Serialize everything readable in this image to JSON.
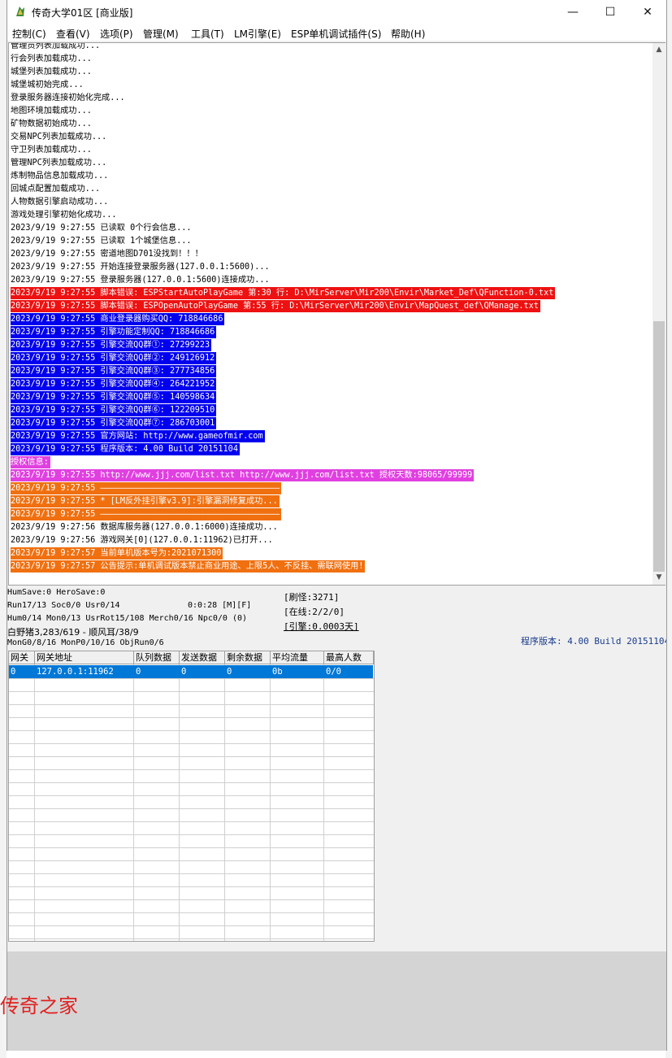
{
  "window": {
    "title": "传奇大学01区 [商业版]",
    "controls": {
      "minimize": "—",
      "maximize": "☐",
      "close": "✕"
    }
  },
  "menu": [
    "控制(C)",
    "查看(V)",
    "选项(P)",
    "管理(M)",
    "工具(T)",
    "LM引擎(E)",
    "ESP单机调试插件(S)",
    "帮助(H)"
  ],
  "log": [
    {
      "text": "管理员列表加载成功...",
      "bg": "",
      "fg": "#000000"
    },
    {
      "text": "行会列表加载成功...",
      "bg": "",
      "fg": "#000000"
    },
    {
      "text": "城堡列表加载成功...",
      "bg": "",
      "fg": "#000000"
    },
    {
      "text": "城堡城初始完成...",
      "bg": "",
      "fg": "#000000"
    },
    {
      "text": "登录服务器连接初始化完成...",
      "bg": "",
      "fg": "#000000"
    },
    {
      "text": "地图环境加载成功...",
      "bg": "",
      "fg": "#000000"
    },
    {
      "text": "矿物数据初始成功...",
      "bg": "",
      "fg": "#000000"
    },
    {
      "text": "交易NPC列表加载成功...",
      "bg": "",
      "fg": "#000000"
    },
    {
      "text": "守卫列表加载成功...",
      "bg": "",
      "fg": "#000000"
    },
    {
      "text": "管理NPC列表加载成功...",
      "bg": "",
      "fg": "#000000"
    },
    {
      "text": "炼制物品信息加载成功...",
      "bg": "",
      "fg": "#000000"
    },
    {
      "text": "回城点配置加载成功...",
      "bg": "",
      "fg": "#000000"
    },
    {
      "text": "人物数据引擎启动成功...",
      "bg": "",
      "fg": "#000000"
    },
    {
      "text": "游戏处理引擎初始化成功...",
      "bg": "",
      "fg": "#000000"
    },
    {
      "text": "2023/9/19 9:27:55 已读取 0个行会信息...",
      "bg": "",
      "fg": "#000000"
    },
    {
      "text": "2023/9/19 9:27:55 已读取 1个城堡信息...",
      "bg": "",
      "fg": "#000000"
    },
    {
      "text": "2023/9/19 9:27:55 密道地图D701没找到！！！",
      "bg": "",
      "fg": "#000000"
    },
    {
      "text": "2023/9/19 9:27:55 开始连接登录服务器(127.0.0.1:5600)...",
      "bg": "",
      "fg": "#000000"
    },
    {
      "text": "2023/9/19 9:27:55 登录服务器(127.0.0.1:5600)连接成功...",
      "bg": "",
      "fg": "#000000"
    },
    {
      "text": "2023/9/19 9:27:55 脚本错误: ESPStartAutoPlayGame 第:30 行: D:\\MirServer\\Mir200\\Envir\\Market_Def\\QFunction-0.txt",
      "bg": "#ee1111",
      "fg": "#ffffff"
    },
    {
      "text": "2023/9/19 9:27:55 脚本错误: ESPOpenAutoPlayGame 第:55 行: D:\\MirServer\\Mir200\\Envir\\MapQuest_def\\QManage.txt",
      "bg": "#ee1111",
      "fg": "#ffffff"
    },
    {
      "text": "2023/9/19 9:27:55 商业登录器购买QQ: 718846686",
      "bg": "#0000ee",
      "fg": "#ffffff"
    },
    {
      "text": "2023/9/19 9:27:55 引擎功能定制QQ: 718846686",
      "bg": "#0000ee",
      "fg": "#ffffff"
    },
    {
      "text": "2023/9/19 9:27:55 引擎交流QQ群①: 27299223",
      "bg": "#0000ee",
      "fg": "#ffffff"
    },
    {
      "text": "2023/9/19 9:27:55 引擎交流QQ群②: 249126912",
      "bg": "#0000ee",
      "fg": "#ffffff"
    },
    {
      "text": "2023/9/19 9:27:55 引擎交流QQ群③: 277734856",
      "bg": "#0000ee",
      "fg": "#ffffff"
    },
    {
      "text": "2023/9/19 9:27:55 引擎交流QQ群④: 264221952",
      "bg": "#0000ee",
      "fg": "#ffffff"
    },
    {
      "text": "2023/9/19 9:27:55 引擎交流QQ群⑤: 140598634",
      "bg": "#0000ee",
      "fg": "#ffffff"
    },
    {
      "text": "2023/9/19 9:27:55 引擎交流QQ群⑥: 122209510",
      "bg": "#0000ee",
      "fg": "#ffffff"
    },
    {
      "text": "2023/9/19 9:27:55 引擎交流QQ群⑦: 286703001",
      "bg": "#0000ee",
      "fg": "#ffffff"
    },
    {
      "text": "2023/9/19 9:27:55 官方网站: http://www.gameofmir.com",
      "bg": "#0000ee",
      "fg": "#ffffff"
    },
    {
      "text": "2023/9/19 9:27:55 程序版本: 4.00 Build 20151104",
      "bg": "#0000ee",
      "fg": "#ffffff"
    },
    {
      "text": "授权信息:",
      "bg": "#e040e0",
      "fg": "#ffffff"
    },
    {
      "text": "2023/9/19 9:27:55 http://www.jjj.com/list.txt http://www.jjj.com/list.txt 授权天数:98065/99999",
      "bg": "#e040e0",
      "fg": "#ffffff"
    },
    {
      "text": "2023/9/19 9:27:55 ————————————————————————————————————",
      "bg": "#f07010",
      "fg": "#ffffff"
    },
    {
      "text": "2023/9/19 9:27:55 * [LM反外挂引擎v3.9]:引擎漏洞修复成功...",
      "bg": "#f07010",
      "fg": "#ffffff"
    },
    {
      "text": "2023/9/19 9:27:55 ————————————————————————————————————",
      "bg": "#f07010",
      "fg": "#ffffff"
    },
    {
      "text": "2023/9/19 9:27:56 数据库服务器(127.0.0.1:6000)连接成功...",
      "bg": "",
      "fg": "#000000"
    },
    {
      "text": "2023/9/19 9:27:56 游戏网关[0](127.0.0.1:11962)已打开...",
      "bg": "",
      "fg": "#000000"
    },
    {
      "text": "2023/9/19 9:27:57 当前单机版本号为:2021071300",
      "bg": "#f07010",
      "fg": "#ffffff"
    },
    {
      "text": "2023/9/19 9:27:57 公告提示:单机调试版本禁止商业用途、上限5人、不反挂、需联网使用!",
      "bg": "#f07010",
      "fg": "#ffffff"
    }
  ],
  "status": {
    "humsave": "HumSave:0 HeroSave:0",
    "run": "Run17/13 Soc0/0 Usr0/14",
    "time": "0:0:28 [M][F]",
    "hum": "Hum0/14 Mon0/13 UsrRot15/108 Merch0/16 Npc0/0 (0)",
    "boar": "白野猪3,283/619 - 顺风耳/38/9",
    "mon": "MonG0/8/16 MonP0/10/16 ObjRun0/6",
    "refresh": "[刷怪:3271]",
    "online": "[在线:2/2/0]",
    "engine": "[引擎:0.0003天]",
    "version": "程序版本: 4.00 Build 20151104"
  },
  "gateway_table": {
    "headers": [
      "网关",
      "网关地址",
      "队列数据",
      "发送数据",
      "剩余数据",
      "平均流量",
      "最高人数"
    ],
    "rows": [
      [
        "0",
        "127.0.0.1:11962",
        "0",
        "0",
        "0",
        "0b",
        "0/0"
      ]
    ]
  },
  "watermark": "传奇之家",
  "colors": {
    "accent": "#0078d7",
    "error": "#ee1111",
    "info": "#0000ee",
    "license": "#e040e0",
    "notice": "#f07010"
  }
}
